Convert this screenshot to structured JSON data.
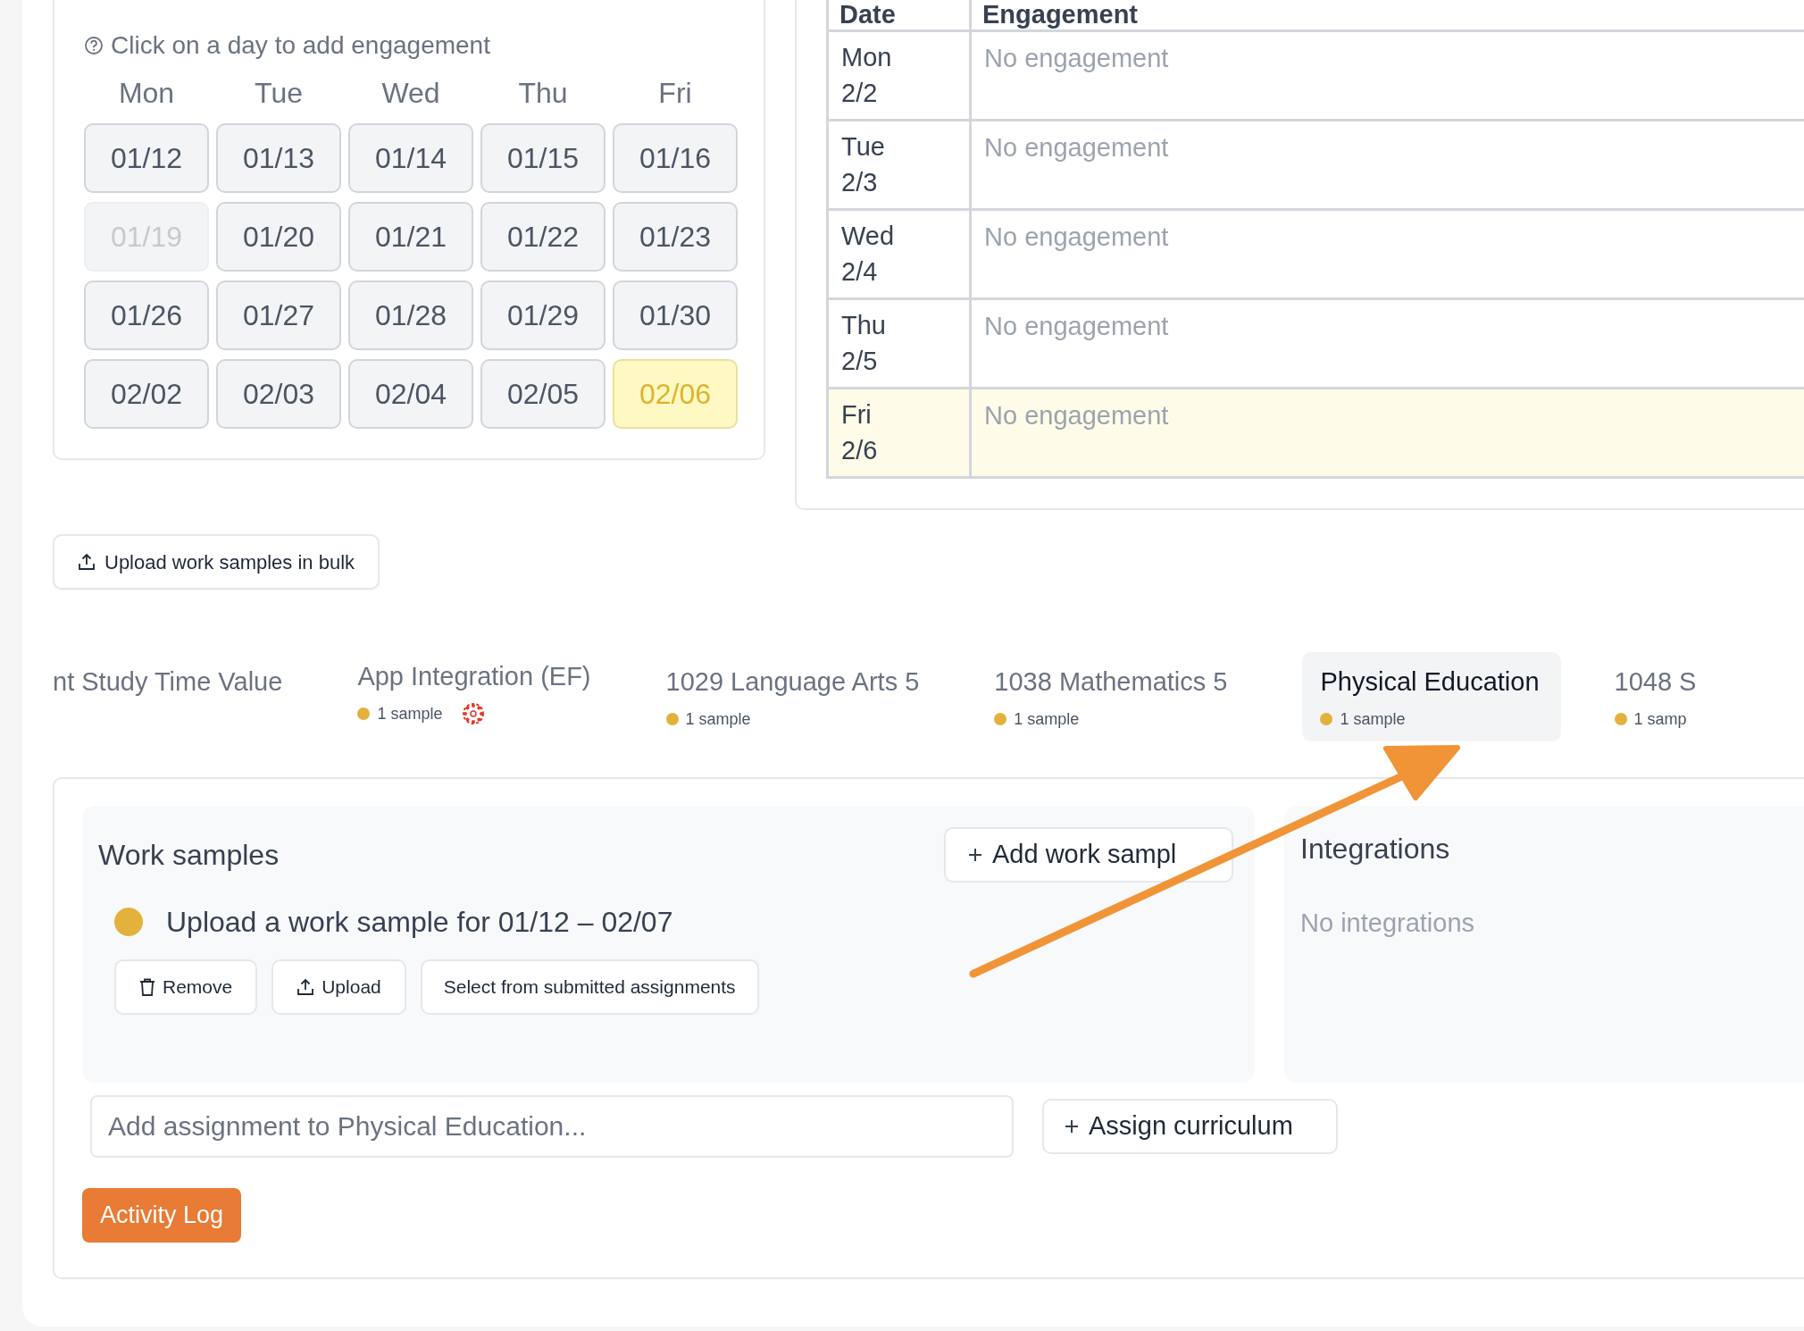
{
  "calendar": {
    "hint": "Click on a day to add engagement",
    "weekdays": [
      "Mon",
      "Tue",
      "Wed",
      "Thu",
      "Fri"
    ],
    "days": [
      {
        "label": "01/12",
        "disabled": false,
        "highlighted": false
      },
      {
        "label": "01/13",
        "disabled": false,
        "highlighted": false
      },
      {
        "label": "01/14",
        "disabled": false,
        "highlighted": false
      },
      {
        "label": "01/15",
        "disabled": false,
        "highlighted": false
      },
      {
        "label": "01/16",
        "disabled": false,
        "highlighted": false
      },
      {
        "label": "01/19",
        "disabled": true,
        "highlighted": false
      },
      {
        "label": "01/20",
        "disabled": false,
        "highlighted": false
      },
      {
        "label": "01/21",
        "disabled": false,
        "highlighted": false
      },
      {
        "label": "01/22",
        "disabled": false,
        "highlighted": false
      },
      {
        "label": "01/23",
        "disabled": false,
        "highlighted": false
      },
      {
        "label": "01/26",
        "disabled": false,
        "highlighted": false
      },
      {
        "label": "01/27",
        "disabled": false,
        "highlighted": false
      },
      {
        "label": "01/28",
        "disabled": false,
        "highlighted": false
      },
      {
        "label": "01/29",
        "disabled": false,
        "highlighted": false
      },
      {
        "label": "01/30",
        "disabled": false,
        "highlighted": false
      },
      {
        "label": "02/02",
        "disabled": false,
        "highlighted": false
      },
      {
        "label": "02/03",
        "disabled": false,
        "highlighted": false
      },
      {
        "label": "02/04",
        "disabled": false,
        "highlighted": false
      },
      {
        "label": "02/05",
        "disabled": false,
        "highlighted": false
      },
      {
        "label": "02/06",
        "disabled": false,
        "highlighted": true
      }
    ]
  },
  "engagement_table": {
    "columns": [
      "Date",
      "Engagement"
    ],
    "rows": [
      {
        "day": "Mon",
        "date": "2/2",
        "engagement": "No engagement",
        "highlighted": false
      },
      {
        "day": "Tue",
        "date": "2/3",
        "engagement": "No engagement",
        "highlighted": false
      },
      {
        "day": "Wed",
        "date": "2/4",
        "engagement": "No engagement",
        "highlighted": false
      },
      {
        "day": "Thu",
        "date": "2/5",
        "engagement": "No engagement",
        "highlighted": false
      },
      {
        "day": "Fri",
        "date": "2/6",
        "engagement": "No engagement",
        "highlighted": true
      }
    ]
  },
  "bulk_upload_button": "Upload work samples in bulk",
  "subject_tabs": [
    {
      "title": "nt Study Time Value",
      "selected": false
    },
    {
      "title": "App Integration (EF)",
      "samples": "1 sample",
      "color": "#e3b23c",
      "integration_icon": true,
      "selected": false
    },
    {
      "title": "1029 Language Arts 5",
      "samples": "1 sample",
      "color": "#e3b23c",
      "selected": false
    },
    {
      "title": "1038 Mathematics 5",
      "samples": "1 sample",
      "color": "#e3b23c",
      "selected": false
    },
    {
      "title": "Physical Education",
      "samples": "1 sample",
      "color": "#e3b23c",
      "selected": true
    },
    {
      "title": "1048 S",
      "samples": "1 samp",
      "color": "#e3b23c",
      "selected": false
    }
  ],
  "work_samples": {
    "title": "Work samples",
    "add_button": "Add work sampl",
    "items": [
      {
        "text": "Upload a work sample for 01/12 – 02/07",
        "color": "#e3b23c",
        "actions": [
          {
            "kind": "remove",
            "label": "Remove"
          },
          {
            "kind": "upload",
            "label": "Upload"
          },
          {
            "kind": "select",
            "label": "Select from submitted assignments"
          }
        ]
      }
    ]
  },
  "integrations": {
    "title": "Integrations",
    "empty_text": "No integrations"
  },
  "assignment_field": {
    "placeholder": "Add assignment to Physical Education..."
  },
  "assign_curriculum_button": "Assign curriculum",
  "activity_log_button": "Activity Log"
}
